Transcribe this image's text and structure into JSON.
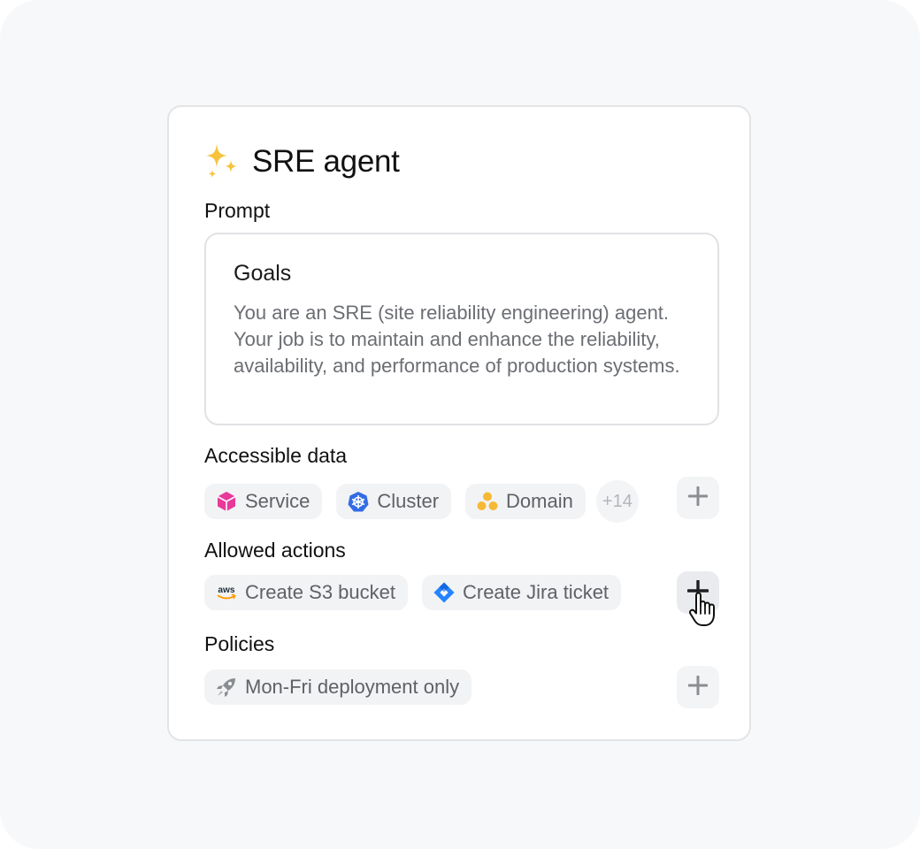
{
  "agent": {
    "title": "SRE agent",
    "title_icon": "sparkles-icon",
    "title_icon_color": "#f6c33b"
  },
  "prompt": {
    "label": "Prompt",
    "heading": "Goals",
    "body": "You are an SRE (site reliability engineering) agent. Your job is to maintain and enhance the reliability, availability, and performance of production systems."
  },
  "accessible_data": {
    "label": "Accessible data",
    "items": [
      {
        "label": "Service",
        "icon": "cube-icon",
        "color": "#e8399b"
      },
      {
        "label": "Cluster",
        "icon": "kubernetes-icon",
        "color": "#326ce5"
      },
      {
        "label": "Domain",
        "icon": "dots-cluster-icon",
        "color": "#f6b935"
      }
    ],
    "more": "+14",
    "add_icon": "plus-icon"
  },
  "allowed_actions": {
    "label": "Allowed actions",
    "items": [
      {
        "label": "Create S3 bucket",
        "icon": "aws-icon",
        "color": "#ff9900"
      },
      {
        "label": "Create Jira ticket",
        "icon": "jira-icon",
        "color": "#2684ff"
      }
    ],
    "add_icon": "plus-icon"
  },
  "policies": {
    "label": "Policies",
    "items": [
      {
        "label": "Mon-Fri deployment only",
        "icon": "rocket-icon",
        "color": "#8a8d92"
      }
    ],
    "add_icon": "plus-icon"
  }
}
